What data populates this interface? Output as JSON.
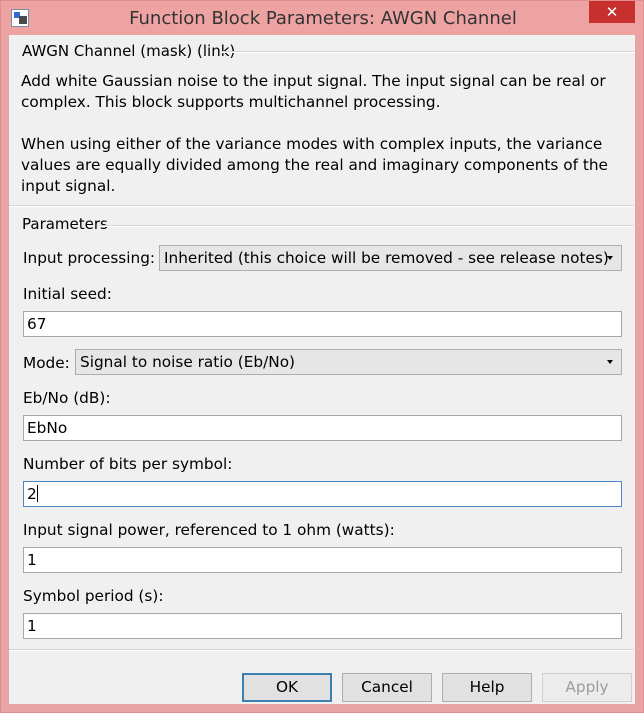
{
  "window": {
    "title": "Function Block Parameters: AWGN Channel",
    "close_glyph": "✕"
  },
  "mask": {
    "header": "AWGN Channel (mask) (link)",
    "description_1": "Add white Gaussian noise to the input signal. The input signal can be real or complex. This block supports multichannel processing.",
    "description_2": "When using either of the variance modes with complex inputs, the variance values are equally divided among the real and imaginary components of the input signal."
  },
  "parameters": {
    "header": "Parameters",
    "input_processing": {
      "label": "Input processing:",
      "value": "Inherited (this choice will be removed - see release notes)"
    },
    "initial_seed": {
      "label": "Initial seed:",
      "value": "67"
    },
    "mode": {
      "label": "Mode:",
      "value": "Signal to noise ratio  (Eb/No)"
    },
    "ebno": {
      "label": "Eb/No (dB):",
      "value": "EbNo"
    },
    "bits_per_symbol": {
      "label": "Number of bits per symbol:",
      "value": "2"
    },
    "input_power": {
      "label": "Input signal power, referenced to 1 ohm (watts):",
      "value": "1"
    },
    "symbol_period": {
      "label": "Symbol period (s):",
      "value": "1"
    }
  },
  "buttons": {
    "ok": "OK",
    "cancel": "Cancel",
    "help": "Help",
    "apply": "Apply"
  },
  "icons": {
    "app": "simulink-block-icon",
    "close": "close-icon",
    "dropdown": "chevron-down-icon"
  },
  "colors": {
    "titlebar": "#eea3a3",
    "close_button": "#c7302c",
    "dialog_bg": "#f0f0f0",
    "focus_border": "#4a86c8"
  }
}
